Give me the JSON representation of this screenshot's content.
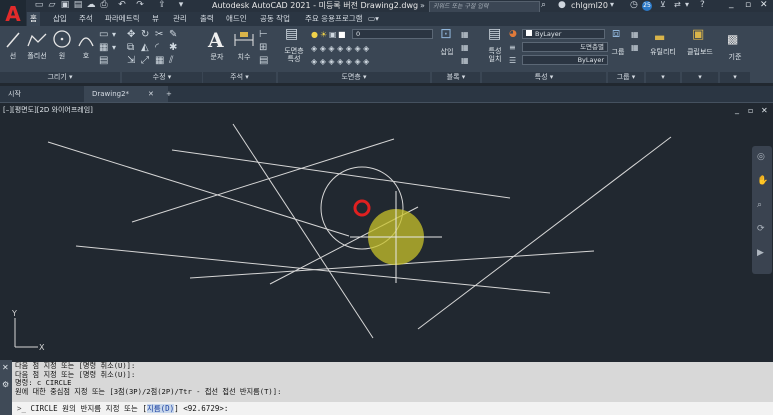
{
  "titlebar": {
    "logo": "A",
    "title": "Autodesk AutoCAD 2021 - 미등록 버전    Drawing2.dwg",
    "search_placeholder": "키워드 또는 구절 입력",
    "user": "chlgml20",
    "notifications": "25"
  },
  "ribbon_tabs": [
    "홈",
    "삽입",
    "주석",
    "파라메트릭",
    "뷰",
    "관리",
    "출력",
    "애드인",
    "공동 작업",
    "주요 응용프로그램"
  ],
  "panels": {
    "draw": "그리기",
    "modify": "수정",
    "annotation": "주석",
    "layers": "도면층",
    "block": "블록",
    "properties": "특성",
    "groups": "그룹",
    "utilities": "유틸리티",
    "clipboard": "클립보드",
    "view": "기준"
  },
  "buttons": {
    "line": "선",
    "polyline": "폴리선",
    "circle": "원",
    "arc": "호",
    "text": "문자",
    "dimension": "치수",
    "layer_props": "도면층\n특성",
    "insert": "삽입",
    "match_props": "특성\n일치",
    "group": "그룹",
    "utilities": "유틸리티",
    "clipboard": "클립보드",
    "base": "기준"
  },
  "layer_value": "0",
  "prop_color": "ByLayer",
  "prop_linetype": "도면층별",
  "prop_lineweight": "ByLayer",
  "file_tabs": {
    "start": "시작",
    "drawing": "Drawing2*",
    "new": "+"
  },
  "viewport_label": "[–][평면도][2D 와이어프레임]",
  "window_controls": {
    "minimize": "_",
    "restore": "▫",
    "close": "✕"
  },
  "ucs": {
    "x": "X",
    "y": "Y"
  },
  "command_history": [
    "다음 점 지정 또는 [명령 취소(U)]:",
    "다음 점 지정 또는 [명령 취소(U)]:",
    "명령: c CIRCLE",
    "원에 대한 중심점 지정 또는 [3점(3P)/2점(2P)/Ttr - 접선 접선 반지름(T)]:"
  ],
  "command_prompt": {
    "prefix": "CIRCLE 원의 반지름 지정 또는 [",
    "option": "지름(D)",
    "suffix": "] <92.6729>:"
  }
}
